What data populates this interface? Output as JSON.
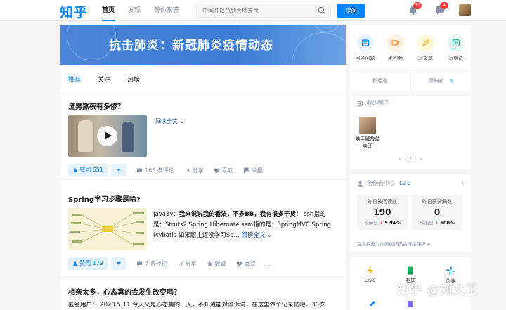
{
  "header": {
    "logo": "知乎",
    "nav": [
      {
        "label": "首页",
        "active": true
      },
      {
        "label": "发现",
        "active": false
      },
      {
        "label": "等你来答",
        "active": false
      }
    ],
    "search_placeholder": "中国驻以色列大使去世",
    "ask_label": "提问",
    "notification_count": "31",
    "message_count": "4"
  },
  "banner": {
    "title": "抗击肺炎：新冠肺炎疫情动态"
  },
  "feed_tabs": [
    "推荐",
    "关注",
    "热榜"
  ],
  "feed": [
    {
      "title": "渣男熬夜有多惨？",
      "read_more": "阅读全文",
      "vote_label": "赞同 651",
      "actions": [
        "165 条评论",
        "分享",
        "喜欢",
        "举报"
      ]
    },
    {
      "title": "Spring学习步骤是啥?",
      "excerpt_author": "Java3y：",
      "excerpt_bold": "我来说说我的看法，不多BB，我有很多干货！",
      "excerpt_rest": " ssh指的是：Struts2 Spring Hibernate ssm指的是：SpringMVC Spring Mybatis 如果题主还没学习Sp...",
      "read_more": "阅读全文",
      "vote_label": "赞同 179",
      "actions": [
        "7 条评论",
        "分享",
        "收藏",
        "喜欢",
        "..."
      ]
    },
    {
      "title": "相亲太多，心态真的会发生改变吗？",
      "excerpt": "匿名用户： 2020.5.11 今天又是心态崩的一天，不知道能对谁诉说，在这里做个记录帖吧。30岁"
    }
  ],
  "sidebar": {
    "quick_actions": [
      {
        "label": "回答问题",
        "icon": "answer-icon",
        "bg": "#e6f1ff"
      },
      {
        "label": "发视频",
        "icon": "video-icon",
        "bg": "#fff1e3"
      },
      {
        "label": "写文章",
        "icon": "article-icon",
        "bg": "#fff8d9"
      },
      {
        "label": "写想法",
        "icon": "idea-icon",
        "bg": "#e3f8f3"
      }
    ],
    "later_label": "稍后答",
    "drafts_label": "草稿箱",
    "drafts_count": "5",
    "circles_title": "我的圈子",
    "circle_name": "随手解放单身汪",
    "pager": "1/1",
    "creator_title": "创作者中心",
    "creator_level": "Lv 3",
    "stats": [
      {
        "label": "昨日被阅读数",
        "value": "190",
        "compare_label": "较前日",
        "compare_value": "5.94%"
      },
      {
        "label": "昨日获赞同数",
        "value": "0",
        "compare_label": "较前日",
        "compare_value": "100%"
      }
    ],
    "protect_text": "互为保護为你的创作提供持续保护",
    "tools": [
      {
        "label": "Live",
        "color": "#f5b400"
      },
      {
        "label": "书店",
        "color": "#1fb364"
      },
      {
        "label": "圆桌",
        "color": "#0aa0db"
      }
    ]
  },
  "watermark": "知乎 @刘文正"
}
